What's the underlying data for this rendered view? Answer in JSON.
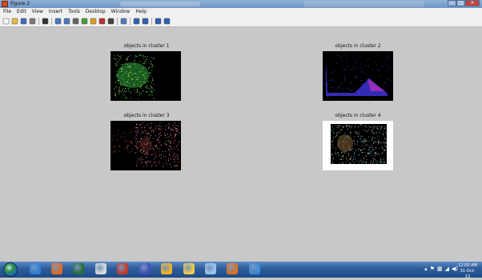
{
  "window": {
    "title": "Figure 2"
  },
  "menu": [
    "File",
    "Edit",
    "View",
    "Insert",
    "Tools",
    "Desktop",
    "Window",
    "Help"
  ],
  "toolbar": [
    {
      "name": "new-figure-icon",
      "color": "#f5f5f5"
    },
    {
      "name": "open-file-icon",
      "color": "#e8b84a"
    },
    {
      "name": "save-icon",
      "color": "#3e6ab8"
    },
    {
      "name": "print-icon",
      "color": "#7a7a7a"
    },
    {
      "sep": true
    },
    {
      "name": "edit-plot-icon",
      "color": "#333333"
    },
    {
      "sep": true
    },
    {
      "name": "zoom-in-icon",
      "color": "#4a78c0"
    },
    {
      "name": "zoom-out-icon",
      "color": "#4a78c0"
    },
    {
      "name": "pan-icon",
      "color": "#666666"
    },
    {
      "name": "rotate-3d-icon",
      "color": "#4a9a3c"
    },
    {
      "name": "data-cursor-icon",
      "color": "#d8a020"
    },
    {
      "name": "brush-icon",
      "color": "#c03030"
    },
    {
      "name": "brush-dropdown-icon",
      "color": "#444444"
    },
    {
      "sep": true
    },
    {
      "name": "link-plot-icon",
      "color": "#4a78c0"
    },
    {
      "sep": true
    },
    {
      "name": "insert-colorbar-icon",
      "color": "#3060b0"
    },
    {
      "name": "insert-legend-icon",
      "color": "#3060b0"
    },
    {
      "sep": true
    },
    {
      "name": "hide-plot-tools-icon",
      "color": "#3060b0"
    },
    {
      "name": "show-plot-tools-icon",
      "color": "#3060b0"
    }
  ],
  "subplots": [
    {
      "title": "objects in cluster 1",
      "palette": "green"
    },
    {
      "title": "objects in cluster 2",
      "palette": "blue"
    },
    {
      "title": "objects in cluster 3",
      "palette": "pink"
    },
    {
      "title": "objects in cluster 4",
      "palette": "cyan"
    }
  ],
  "taskbar": {
    "apps": [
      {
        "name": "internet-explorer-icon",
        "color": "#2f7fd6"
      },
      {
        "name": "firefox-icon",
        "color": "#e56a1c"
      },
      {
        "name": "media-center-icon",
        "color": "#2a6f3a"
      },
      {
        "name": "chrome-icon",
        "color": "#d8d8d8"
      },
      {
        "name": "java-icon",
        "color": "#c23b2b"
      },
      {
        "name": "vlc-icon",
        "color": "#4150b8"
      },
      {
        "name": "chrome-app-icon",
        "color": "#f0b020"
      },
      {
        "name": "file-explorer-icon",
        "color": "#f2c84a"
      },
      {
        "name": "notepad-icon",
        "color": "#9cc3ea"
      },
      {
        "name": "matlab-icon",
        "color": "#e0701e"
      },
      {
        "name": "player-icon",
        "color": "#3a8ad6"
      }
    ],
    "time": "12:00 AM",
    "date": "31-Oct-13"
  }
}
